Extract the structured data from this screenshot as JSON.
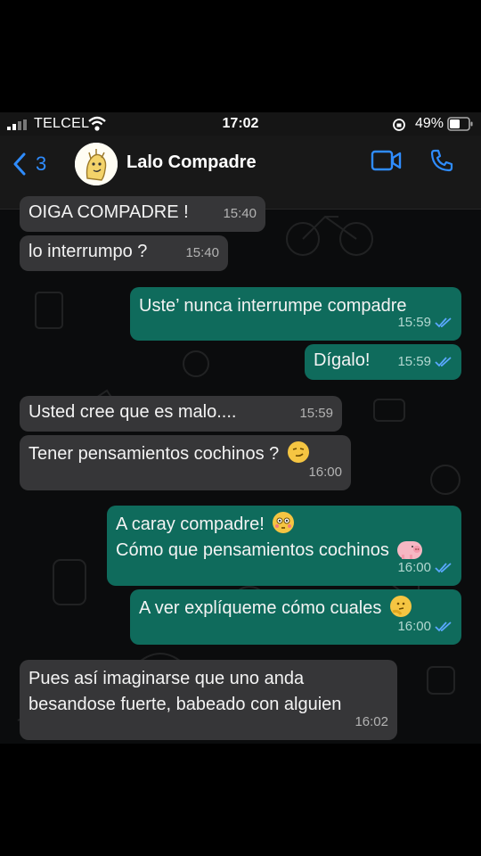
{
  "status_bar": {
    "carrier": "TELCEL",
    "time": "17:02",
    "battery": "49%"
  },
  "header": {
    "back_count": "3",
    "contact_name": "Lalo Compadre",
    "icons": [
      "chevron-left-icon",
      "video-call-icon",
      "phone-icon"
    ]
  },
  "messages": [
    {
      "dir": "in",
      "text": "OIGA COMPADRE !",
      "time": "15:40"
    },
    {
      "dir": "in",
      "text": "lo interrumpo ?",
      "time": "15:40"
    },
    {
      "dir": "out",
      "text": "Uste’ nunca interrumpe compadre",
      "time": "15:59"
    },
    {
      "dir": "out",
      "text": "Dígalo!",
      "time": "15:59"
    },
    {
      "dir": "in",
      "text": "Usted cree que es malo....",
      "time": "15:59"
    },
    {
      "dir": "in",
      "text": "Tener pensamientos cochinos ?",
      "time": "16:00",
      "emoji": "smirking-face"
    },
    {
      "dir": "out",
      "line1": "A caray compadre!",
      "line1_emoji": "flushed-face",
      "line2": "Cómo que pensamientos cochinos",
      "line2_emoji": "pig",
      "time": "16:00"
    },
    {
      "dir": "out",
      "text": "A ver explíqueme cómo cuales",
      "time": "16:00",
      "emoji": "thinking-face"
    },
    {
      "dir": "in",
      "line1": "Pues así imaginarse que uno anda",
      "line2": "besandose fuerte, babeado con alguien",
      "time": "16:02"
    }
  ],
  "colors": {
    "incoming_bubble": "#363638",
    "outgoing_bubble": "#0f6b5c",
    "accent": "#2f8cff",
    "read_tick": "#5aa8ff"
  }
}
